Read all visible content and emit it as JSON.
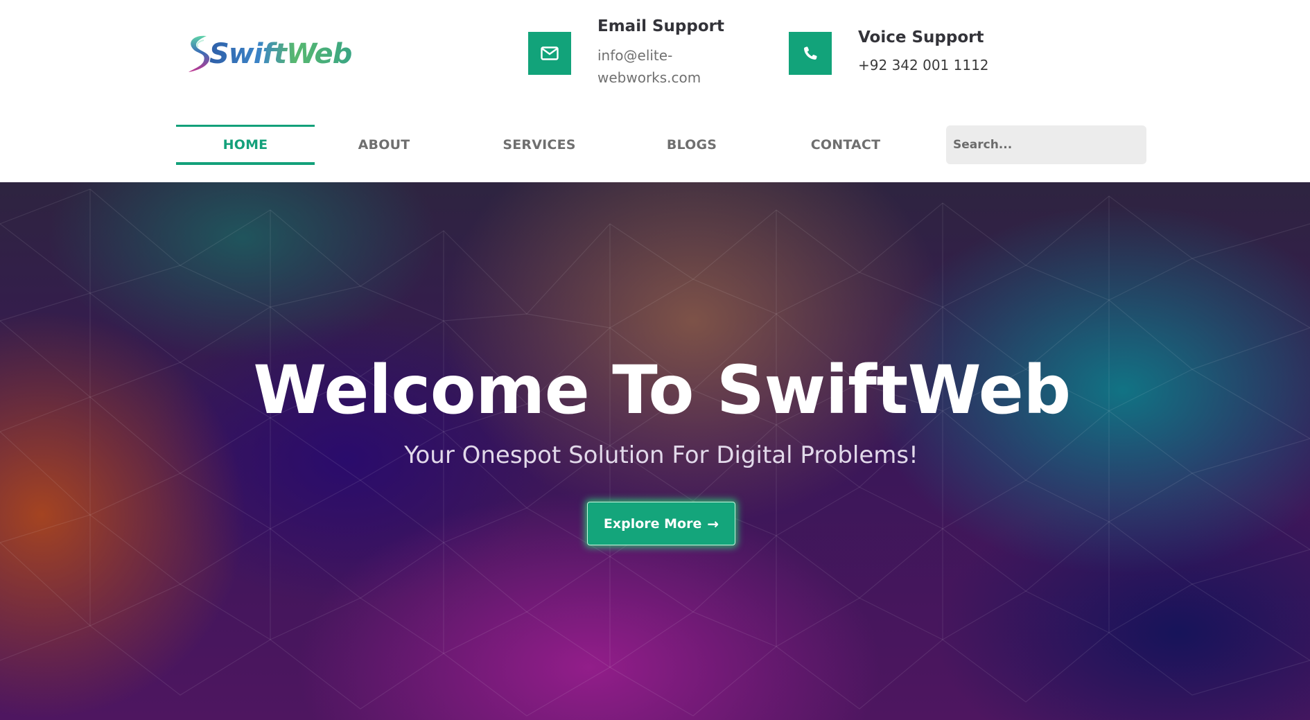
{
  "brand": {
    "name": "SwiftWeb",
    "accent_color": "#13a07a"
  },
  "contacts": {
    "email": {
      "icon": "envelope-icon",
      "title": "Email Support",
      "value": "info@elite-webworks.com"
    },
    "voice": {
      "icon": "phone-icon",
      "title": "Voice Support",
      "value": "+92 342 001 1112"
    }
  },
  "nav": {
    "items": [
      {
        "label": "HOME",
        "active": true
      },
      {
        "label": "ABOUT",
        "active": false
      },
      {
        "label": "SERVICES",
        "active": false
      },
      {
        "label": "BLOGS",
        "active": false
      },
      {
        "label": "CONTACT",
        "active": false
      }
    ],
    "search": {
      "placeholder": "Search...",
      "value": ""
    }
  },
  "hero": {
    "title": "Welcome To SwiftWeb",
    "subtitle": "Your Onespot Solution For Digital Problems!",
    "cta_label": "Explore More",
    "cta_icon": "arrow-right-icon"
  }
}
